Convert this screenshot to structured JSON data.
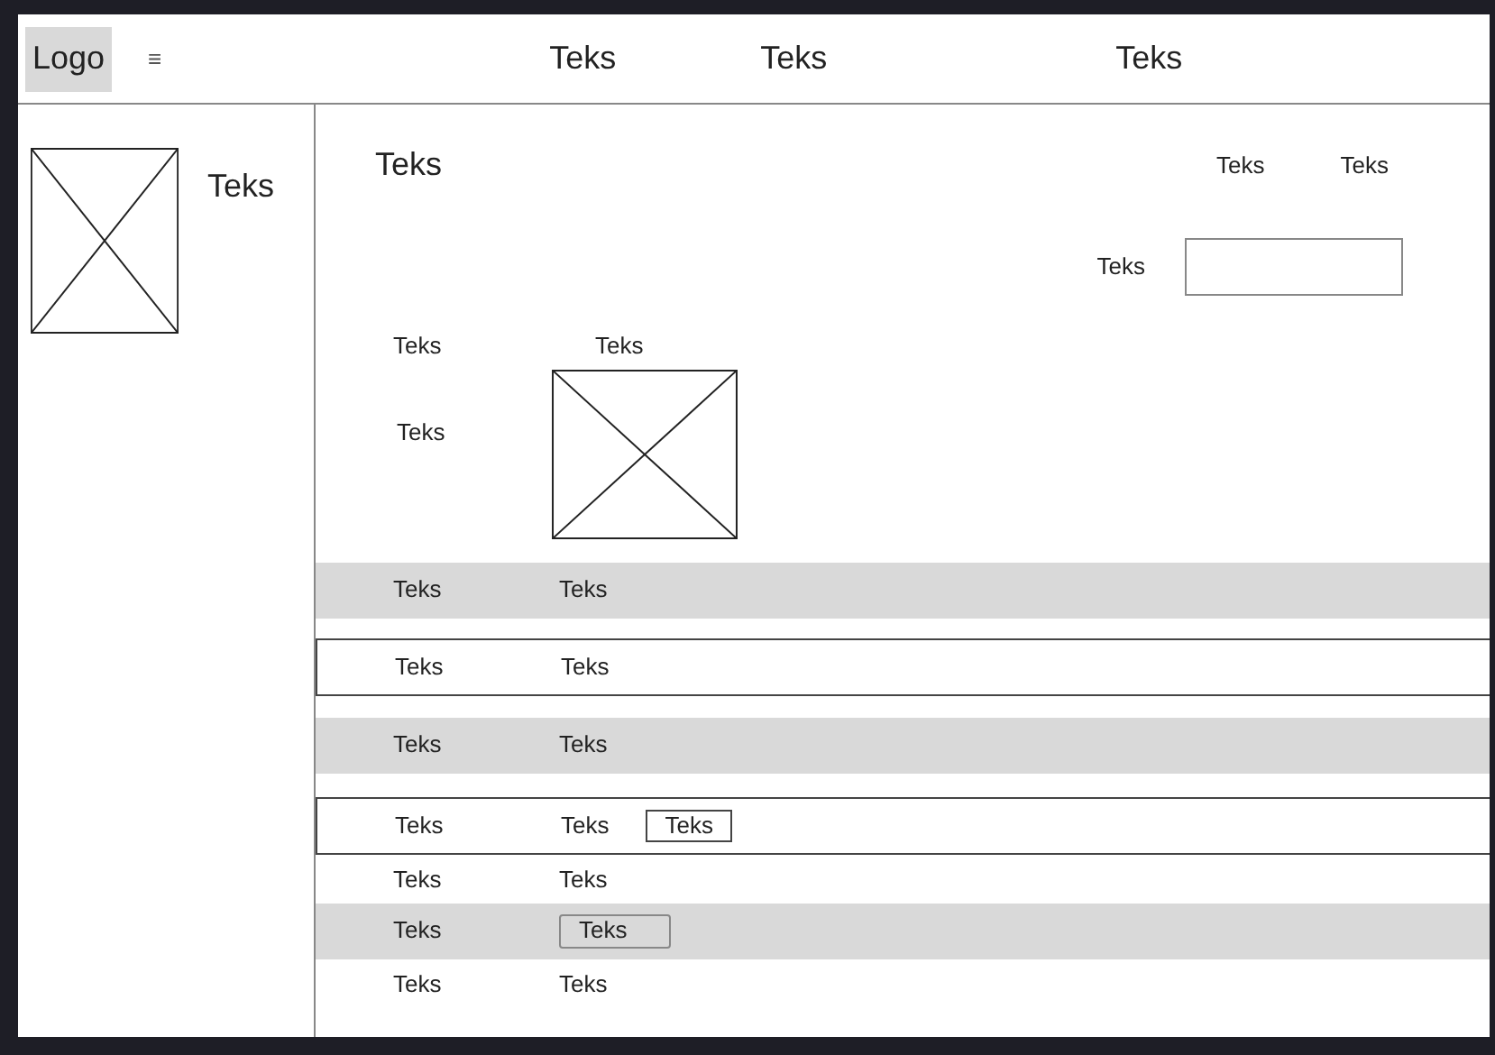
{
  "header": {
    "logo": "Logo",
    "menu": "≡",
    "nav": [
      "Teks",
      "Teks",
      "Teks"
    ]
  },
  "sidebar": {
    "title": "Teks"
  },
  "main": {
    "title": "Teks",
    "links": [
      "Teks",
      "Teks"
    ],
    "field": {
      "label": "Teks"
    },
    "column_1": [
      "Teks",
      "Teks"
    ],
    "column_2": {
      "label": "Teks"
    },
    "rows": [
      {
        "kind": "shaded",
        "cells": [
          "Teks",
          "Teks"
        ]
      },
      {
        "kind": "bordered",
        "cells": [
          "Teks",
          "Teks"
        ]
      },
      {
        "kind": "shaded",
        "cells": [
          "Teks",
          "Teks"
        ]
      },
      {
        "kind": "bordered",
        "cells": [
          "Teks",
          "Teks"
        ],
        "button": {
          "kind": "outline",
          "label": "Teks"
        }
      },
      {
        "kind": "plain",
        "cells": [
          "Teks",
          "Teks"
        ]
      },
      {
        "kind": "shaded",
        "cells": [
          "Teks"
        ],
        "button": {
          "kind": "filled",
          "label": "Teks"
        }
      },
      {
        "kind": "plain",
        "cells": [
          "Teks",
          "Teks"
        ]
      }
    ]
  }
}
